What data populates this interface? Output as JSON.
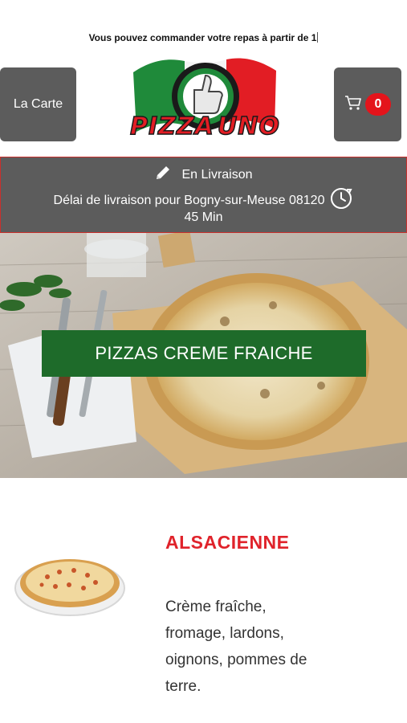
{
  "ticker": {
    "text": "Vous pouvez commander votre repas à partir de 1"
  },
  "header": {
    "menu_label": "La Carte",
    "cart_count": "0",
    "logo_text_left": "PIZZA",
    "logo_text_right": "UNO"
  },
  "delivery": {
    "mode": "En Livraison",
    "delay_text": "Délai de livraison pour Bogny-sur-Meuse 08120",
    "duration": "45 Min"
  },
  "category": {
    "title": "PIZZAS CREME FRAICHE"
  },
  "product": {
    "name": "ALSACIENNE",
    "description": "Crème fraîche, fromage, lardons, oignons, pommes de terre."
  },
  "colors": {
    "header_button_bg": "#5c5c5c",
    "badge_red": "#e4141b",
    "category_green": "#1e6b2a",
    "product_name_red": "#e0232b",
    "delivery_border": "#c9302c"
  },
  "icons": [
    "cart-icon",
    "pencil-icon",
    "clock-icon"
  ]
}
